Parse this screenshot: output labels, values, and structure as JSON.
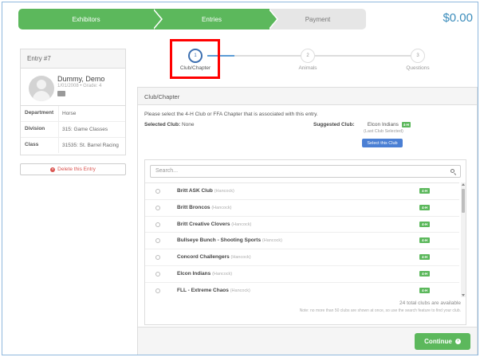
{
  "steps": [
    {
      "label": "Exhibitors"
    },
    {
      "label": "Entries"
    },
    {
      "label": "Payment"
    }
  ],
  "cart_total": "$0.00",
  "entry_card": {
    "title": "Entry #7",
    "name": "Dummy, Demo",
    "subtitle": "1/01/2008 • Grade: 4",
    "fields": [
      {
        "key": "Department",
        "value": "Horse"
      },
      {
        "key": "Division",
        "value": "315: Game Classes"
      },
      {
        "key": "Class",
        "value": "31535: St. Barrel Racing"
      }
    ]
  },
  "delete_label": "Delete this Entry",
  "wizard": [
    {
      "num": "1",
      "label": "Club/Chapter"
    },
    {
      "num": "2",
      "label": "Animals"
    },
    {
      "num": "3",
      "label": "Questions"
    }
  ],
  "panel": {
    "title": "Club/Chapter",
    "instructions": "Please select the 4-H Club or FFA Chapter that is associated with this entry.",
    "selected_label": "Selected Club:",
    "selected_value": "None",
    "suggested_label": "Suggested Club:",
    "suggested_value": "Elcon Indians",
    "suggested_tag": "4-H",
    "last_selected": "(Last Club Selected)",
    "select_button": "Select this Club",
    "search_placeholder": "Search...",
    "clubs": [
      {
        "name": "Britt ASK Club",
        "county": "(Hancock)",
        "tag": "4-H"
      },
      {
        "name": "Britt Broncos",
        "county": "(Hancock)",
        "tag": "4-H"
      },
      {
        "name": "Britt Creative Clovers",
        "county": "(Hancock)",
        "tag": "4-H"
      },
      {
        "name": "Bullseye Bunch - Shooting Sports",
        "county": "(Hancock)",
        "tag": "4-H"
      },
      {
        "name": "Concord Challengers",
        "county": "(Hancock)",
        "tag": "4-H"
      },
      {
        "name": "Elcon Indians",
        "county": "(Hancock)",
        "tag": "4-H"
      },
      {
        "name": "FLL - Extreme Chaos",
        "county": "(Hancock)",
        "tag": "4-H"
      }
    ],
    "count_text": "24 total clubs are available",
    "note_text": "Note: no more than 50 clubs are shown at once, so use the search feature to find your club.",
    "continue_label": "Continue"
  },
  "colors": {
    "accent_green": "#5cb85c",
    "link_blue": "#3c8dbc",
    "highlight_red": "#ff0000"
  }
}
